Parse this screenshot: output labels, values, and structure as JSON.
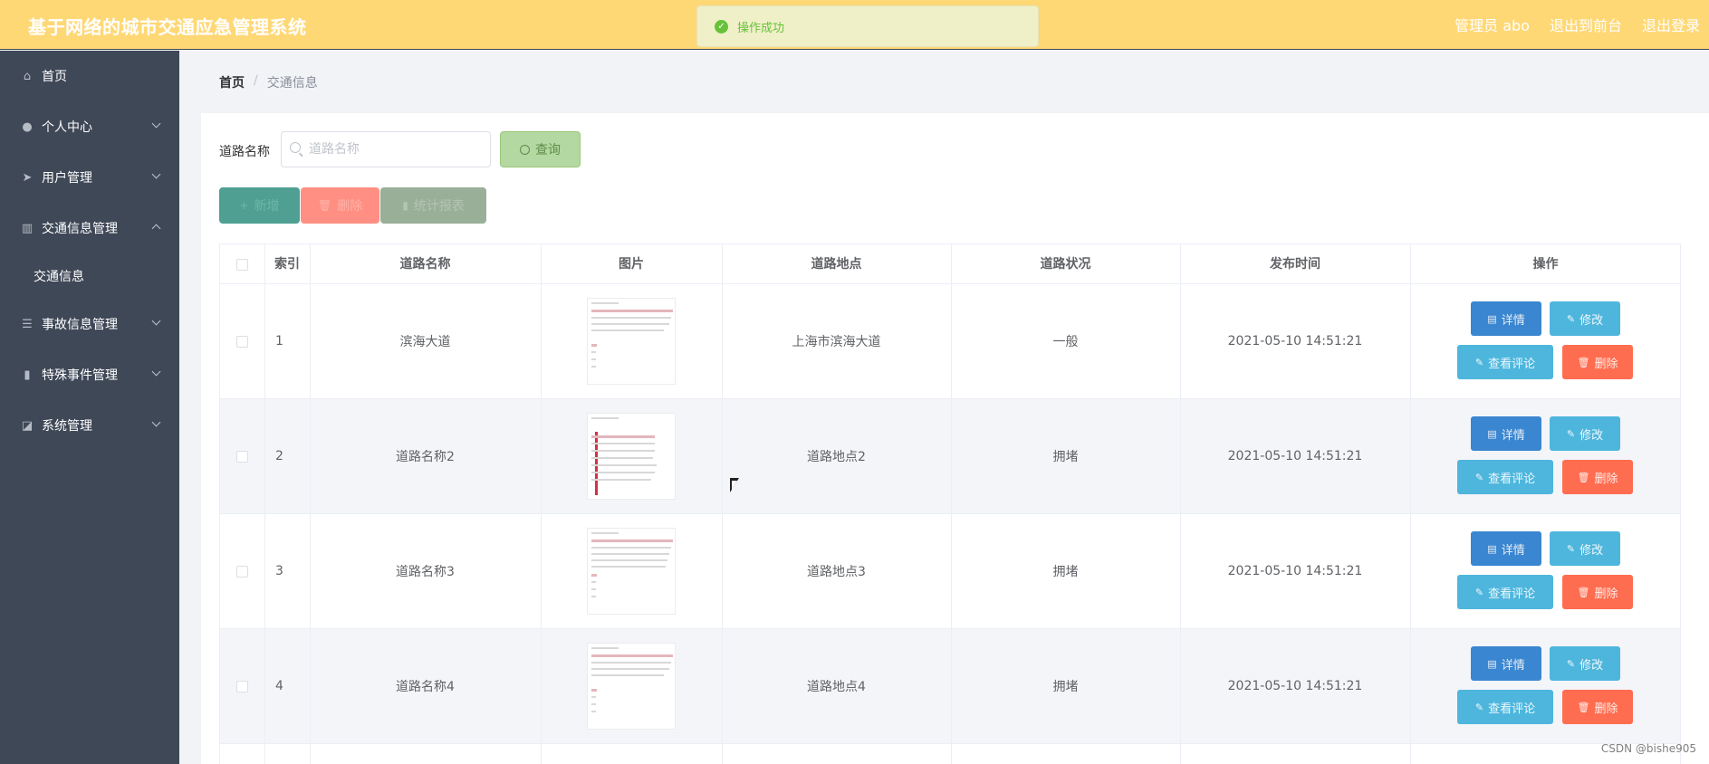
{
  "header": {
    "title": "基于网络的城市交通应急管理系统",
    "admin_label": "管理员 abo",
    "to_frontend": "退出到前台",
    "logout": "退出登录"
  },
  "toast": {
    "message": "操作成功"
  },
  "sidebar": {
    "items": [
      {
        "label": "首页",
        "icon": "home-icon"
      },
      {
        "label": "个人中心",
        "icon": "user-icon"
      },
      {
        "label": "用户管理",
        "icon": "paper-plane-icon"
      },
      {
        "label": "交通信息管理",
        "icon": "columns-icon"
      },
      {
        "label": "事故信息管理",
        "icon": "list-icon"
      },
      {
        "label": "特殊事件管理",
        "icon": "bar-chart-icon"
      },
      {
        "label": "系统管理",
        "icon": "line-chart-icon"
      }
    ],
    "submenu": {
      "label": "交通信息"
    }
  },
  "breadcrumb": {
    "home": "首页",
    "separator": "/",
    "current": "交通信息"
  },
  "search": {
    "label": "道路名称",
    "placeholder": "道路名称",
    "query_label": "查询"
  },
  "toolbar": {
    "add_label": "新增",
    "delete_label": "删除",
    "report_label": "统计报表"
  },
  "table": {
    "columns": [
      "索引",
      "道路名称",
      "图片",
      "道路地点",
      "道路状况",
      "发布时间",
      "操作"
    ],
    "rows": [
      {
        "index": "1",
        "name": "滨海大道",
        "location": "上海市滨海大道",
        "status": "一般",
        "time": "2021-05-10 14:51:21"
      },
      {
        "index": "2",
        "name": "道路名称2",
        "location": "道路地点2",
        "status": "拥堵",
        "time": "2021-05-10 14:51:21"
      },
      {
        "index": "3",
        "name": "道路名称3",
        "location": "道路地点3",
        "status": "拥堵",
        "time": "2021-05-10 14:51:21"
      },
      {
        "index": "4",
        "name": "道路名称4",
        "location": "道路地点4",
        "status": "拥堵",
        "time": "2021-05-10 14:51:21"
      }
    ],
    "row_actions": {
      "detail": "详情",
      "edit": "修改",
      "comment": "查看评论",
      "delete": "删除"
    }
  },
  "watermark": "CSDN @bishe905"
}
